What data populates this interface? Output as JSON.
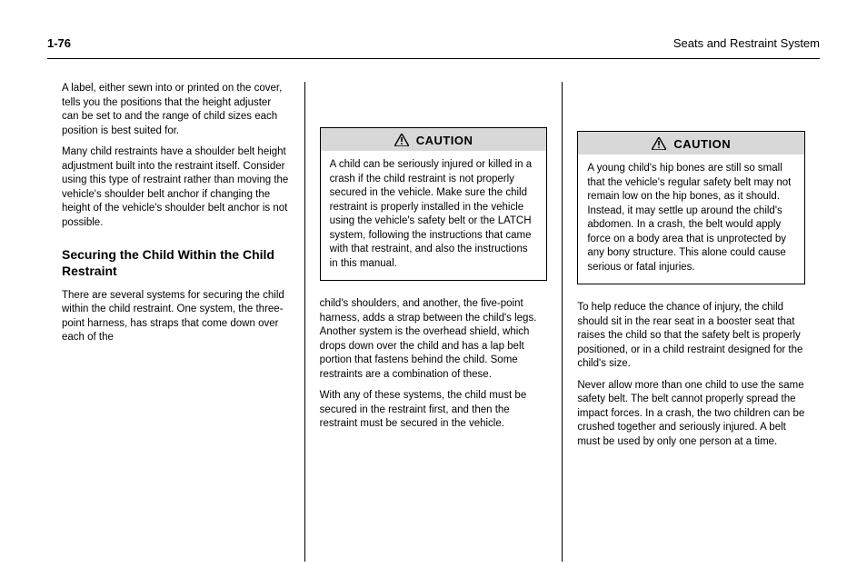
{
  "header": {
    "left": "1-76",
    "right": "Seats and Restraint System"
  },
  "col1": {
    "paragraphs": [
      "A label, either sewn into or printed on the cover, tells you the positions that the height adjuster can be set to and the range of child sizes each position is best suited for.",
      "Many child restraints have a shoulder belt height adjustment built into the restraint itself. Consider using this type of restraint rather than moving the vehicle's shoulder belt anchor if changing the height of the vehicle's shoulder belt anchor is not possible."
    ],
    "subhead": "Securing the Child Within the Child Restraint",
    "post_subhead": "There are several systems for securing the child within the child restraint. One system, the three-point harness, has straps that come down over each of the"
  },
  "col2": {
    "caution": {
      "label": "CAUTION",
      "body": "A child can be seriously injured or killed in a crash if the child restraint is not properly secured in the vehicle. Make sure the child restraint is properly installed in the vehicle using the vehicle's safety belt or the LATCH system, following the instructions that came with that restraint, and also the instructions in this manual."
    },
    "paragraphs": [
      "child's shoulders, and another, the five-point harness, adds a strap between the child's legs. Another system is the overhead shield, which drops down over the child and has a lap belt portion that fastens behind the child. Some restraints are a combination of these.",
      "With any of these systems, the child must be secured in the restraint first, and then the restraint must be secured in the vehicle."
    ]
  },
  "col3": {
    "caution": {
      "label": "CAUTION",
      "body": "A young child's hip bones are still so small that the vehicle's regular safety belt may not remain low on the hip bones, as it should. Instead, it may settle up around the child's abdomen. In a crash, the belt would apply force on a body area that is unprotected by any bony structure. This alone could cause serious or fatal injuries."
    },
    "paragraphs": [
      "To help reduce the chance of injury, the child should sit in the rear seat in a booster seat that raises the child so that the safety belt is properly positioned, or in a child restraint designed for the child's size.",
      "Never allow more than one child to use the same safety belt. The belt cannot properly spread the impact forces. In a crash, the two children can be crushed together and seriously injured. A belt must be used by only one person at a time."
    ]
  },
  "icons": {
    "warning": "warning-triangle-icon"
  }
}
